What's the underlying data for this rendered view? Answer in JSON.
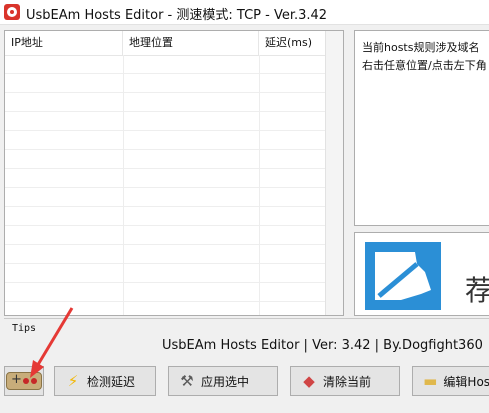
{
  "window": {
    "title": "UsbEAm Hosts Editor - 测速模式: TCP - Ver.3.42",
    "icon": "app-logo-icon"
  },
  "host_table": {
    "columns": [
      "IP地址",
      "地理位置",
      "延迟(ms)"
    ],
    "rows": []
  },
  "info_panel": {
    "line1": "当前hosts规则涉及域名",
    "line2": "右击任意位置/点击左下角"
  },
  "logo_panel": {
    "glyph": "荐"
  },
  "tips": {
    "label": "Tips"
  },
  "status": {
    "text": "UsbEAm Hosts Editor | Ver: 3.42 | By.Dogfight360"
  },
  "buttons": {
    "check_delay": "检测延迟",
    "apply_selected": "应用选中",
    "clear_current": "清除当前",
    "edit_hosts": "编辑Hosts"
  },
  "colors": {
    "accent_blue": "#2b8fd6",
    "arrow_red": "#e53935",
    "app_red": "#d9342b"
  }
}
